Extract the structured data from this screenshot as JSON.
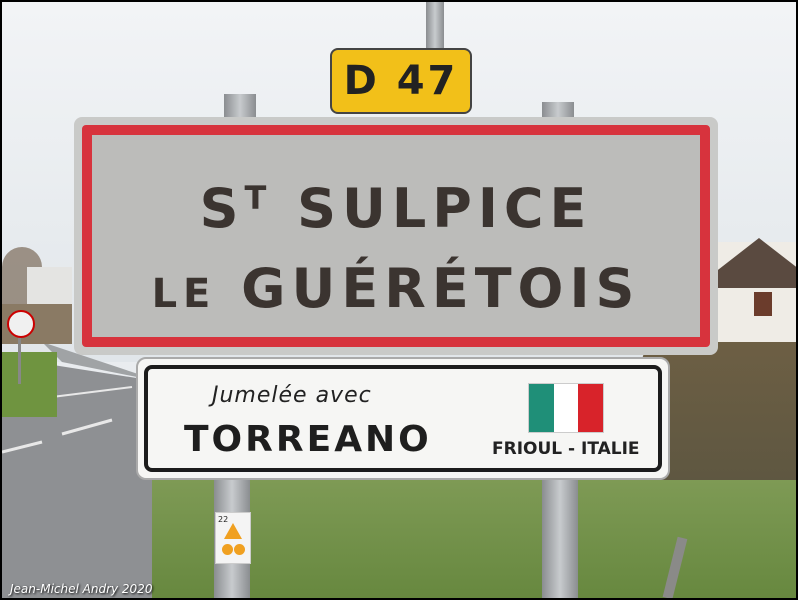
{
  "road_sign": {
    "label": "D 47"
  },
  "town_sign": {
    "line1_prefix": "S",
    "line1_sup": "T",
    "line1_rest": " SULPICE",
    "line2_small": "LE",
    "line2_rest": " GUÉRÉTOIS"
  },
  "twin_sign": {
    "caption": "Jumelée avec",
    "city": "TORREANO",
    "region": "FRIOUL - ITALIE",
    "flag_colors": [
      "#1f8f78",
      "#ffffff",
      "#d8232a"
    ]
  },
  "sticker": {
    "number": "22"
  },
  "credit": "Jean-Michel Andry 2020",
  "colors": {
    "border_red": "#d7333d",
    "yellow": "#f2c019"
  }
}
